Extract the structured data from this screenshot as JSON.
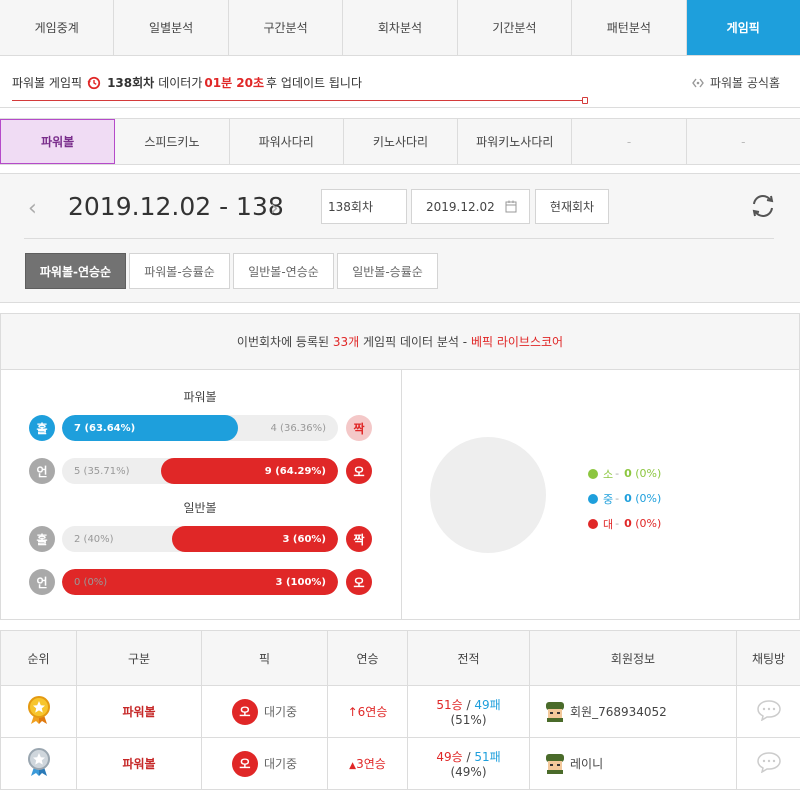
{
  "top_tabs": [
    "게임중계",
    "일별분석",
    "구간분석",
    "회차분석",
    "기간분석",
    "패턴분석",
    "게임픽"
  ],
  "info": {
    "prefix": "파워볼 게임픽",
    "round": "138회차",
    "mid": "데이터가",
    "time": "01분 20초",
    "suffix": "후 업데이트 됩니다",
    "official_link": "파워볼 공식홈"
  },
  "game_tabs": [
    "파워볼",
    "스피드키노",
    "파워사다리",
    "키노사다리",
    "파워키노사다리",
    "-",
    "-"
  ],
  "round_panel": {
    "title": "2019.12.02 - 138",
    "round_box": "138회차",
    "date_box": "2019.12.02",
    "current_button": "현재회차",
    "sort_buttons": [
      "파워볼-연승순",
      "파워볼-승률순",
      "일반볼-연승순",
      "일반볼-승률순"
    ]
  },
  "analysis": {
    "head_pre": "이번회차에 등록된",
    "count": "33개",
    "head_mid": "게임픽 데이터 분석 -",
    "source": "베픽 라이브스코어",
    "powerball_title": "파워볼",
    "normalball_title": "일반볼",
    "bars": [
      {
        "left": "홀",
        "right": "짝",
        "left_label": "7 (63.64%)",
        "right_label": "4 (36.36%)",
        "left_fraction": 0.6364,
        "winner": "left"
      },
      {
        "left": "언",
        "right": "오",
        "left_label": "5 (35.71%)",
        "right_label": "9 (64.29%)",
        "left_fraction": 0.3571,
        "winner": "right"
      },
      {
        "left": "홀",
        "right": "짝",
        "left_label": "2 (40%)",
        "right_label": "3 (60%)",
        "left_fraction": 0.4,
        "winner": "right"
      },
      {
        "left": "언",
        "right": "오",
        "left_label": "0 (0%)",
        "right_label": "3 (100%)",
        "left_fraction": 0.0,
        "winner": "right"
      }
    ],
    "legend": [
      {
        "name": "소",
        "value": "0",
        "pct": "(0%)",
        "color": "#8cc63f"
      },
      {
        "name": "중",
        "value": "0",
        "pct": "(0%)",
        "color": "#1e9fdc"
      },
      {
        "name": "대",
        "value": "0",
        "pct": "(0%)",
        "color": "#e02727"
      }
    ]
  },
  "table": {
    "headers": [
      "순위",
      "구분",
      "픽",
      "연승",
      "전적",
      "회원정보",
      "채팅방"
    ],
    "rows": [
      {
        "type": "파워볼",
        "pick": "오",
        "status": "대기중",
        "streak": "6연승",
        "wins": "51승",
        "losses": "49패",
        "rate": "(51%)",
        "member": "회원_768934052"
      },
      {
        "type": "파워볼",
        "pick": "오",
        "status": "대기중",
        "streak": "3연승",
        "wins": "49승",
        "losses": "51패",
        "rate": "(49%)",
        "member": "레이니"
      }
    ]
  }
}
